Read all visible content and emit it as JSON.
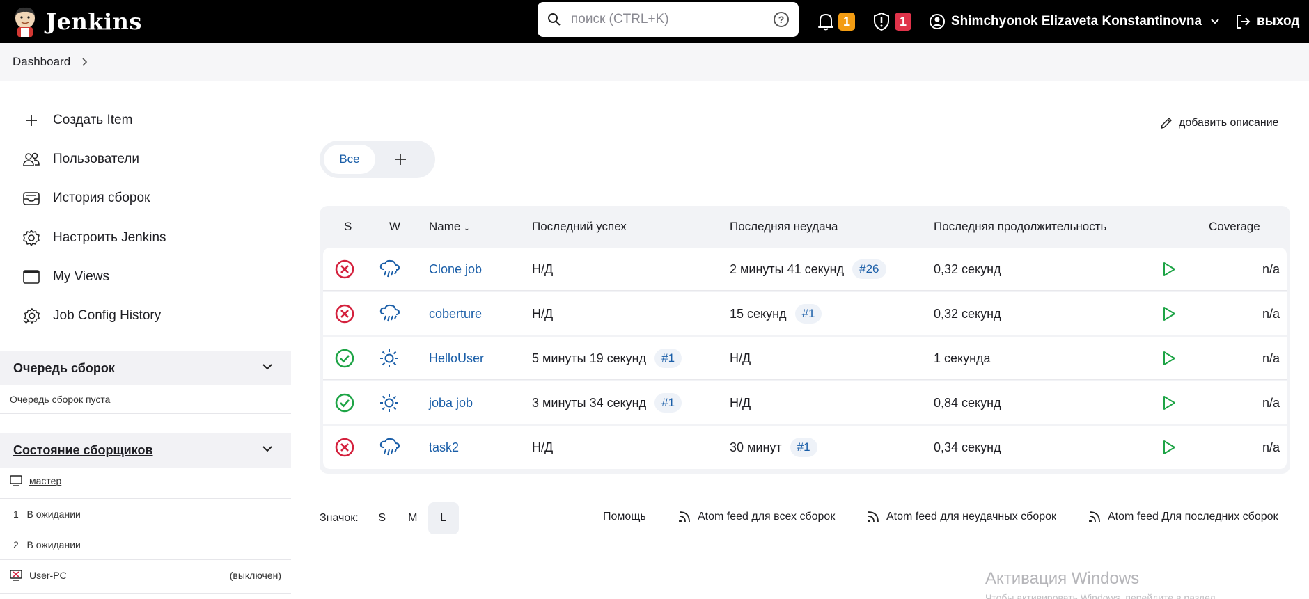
{
  "header": {
    "title": "Jenkins",
    "search_placeholder": "поиск (CTRL+K)",
    "help_glyph": "?",
    "notifications_count": "1",
    "security_count": "1",
    "user_name": "Shimchyonok Elizaveta Konstantinovna",
    "logout_label": "выход"
  },
  "breadcrumb": {
    "items": [
      "Dashboard"
    ]
  },
  "side_menu": {
    "items": [
      {
        "label": "Создать Item",
        "icon": "plus-icon"
      },
      {
        "label": "Пользователи",
        "icon": "people-icon"
      },
      {
        "label": "История сборок",
        "icon": "inbox-icon"
      },
      {
        "label": "Настроить Jenkins",
        "icon": "gear-icon"
      },
      {
        "label": "My Views",
        "icon": "window-icon"
      },
      {
        "label": "Job Config History",
        "icon": "gear-history-icon"
      }
    ]
  },
  "build_queue": {
    "title": "Очередь сборок",
    "empty_text": "Очередь сборок пуста"
  },
  "executors": {
    "title": "Состояние сборщиков",
    "nodes": [
      {
        "name": "мастер",
        "executors": [
          {
            "num": "1",
            "state": "В ожидании"
          },
          {
            "num": "2",
            "state": "В ожидании"
          }
        ]
      },
      {
        "name": "User-PC",
        "status": "(выключен)"
      }
    ]
  },
  "main": {
    "add_description": "добавить описание",
    "tabs": [
      {
        "label": "Все"
      }
    ],
    "add_tab_glyph": "+",
    "columns": {
      "s": "S",
      "w": "W",
      "name": "Name ↓",
      "last_success": "Последний успех",
      "last_failure": "Последняя неудача",
      "last_duration": "Последняя продолжительность",
      "coverage": "Coverage"
    },
    "jobs": [
      {
        "status": "failed",
        "weather": "rain",
        "name": "Clone job",
        "last_success": "Н/Д",
        "success_build": "",
        "last_failure": "2 минуты 41 секунд",
        "failure_build": "#26",
        "duration": "0,32 секунд",
        "coverage": "n/a"
      },
      {
        "status": "failed",
        "weather": "rain",
        "name": "coberture",
        "last_success": "Н/Д",
        "success_build": "",
        "last_failure": "15 секунд",
        "failure_build": "#1",
        "duration": "0,32 секунд",
        "coverage": "n/a"
      },
      {
        "status": "success",
        "weather": "sunny",
        "name": "HelloUser",
        "last_success": "5 минуты 19 секунд",
        "success_build": "#1",
        "last_failure": "Н/Д",
        "failure_build": "",
        "duration": "1 секунда",
        "coverage": "n/a"
      },
      {
        "status": "success",
        "weather": "sunny",
        "name": "joba job",
        "last_success": "3 минуты 34 секунд",
        "success_build": "#1",
        "last_failure": "Н/Д",
        "failure_build": "",
        "duration": "0,84 секунд",
        "coverage": "n/a"
      },
      {
        "status": "failed",
        "weather": "rain",
        "name": "task2",
        "last_success": "Н/Д",
        "success_build": "",
        "last_failure": "30 минут",
        "failure_build": "#1",
        "duration": "0,34 секунд",
        "coverage": "n/a"
      }
    ],
    "icon_size": {
      "label": "Значок:",
      "options": [
        "S",
        "M",
        "L"
      ],
      "selected": "L"
    },
    "footer_links": {
      "help": "Помощь",
      "feed_all": "Atom feed для всех сборок",
      "feed_failed": "Atom feed для неудачных сборок",
      "feed_latest": "Atom feed Для последних сборок"
    }
  },
  "watermark": {
    "line1": "Активация Windows",
    "line2": "Чтобы активировать Windows, перейдите в раздел"
  },
  "colors": {
    "accent": "#1a5ea8",
    "failed": "#d4213d",
    "success": "#1ea446",
    "warning_badge": "#f39c12",
    "security_badge": "#e0334a"
  }
}
